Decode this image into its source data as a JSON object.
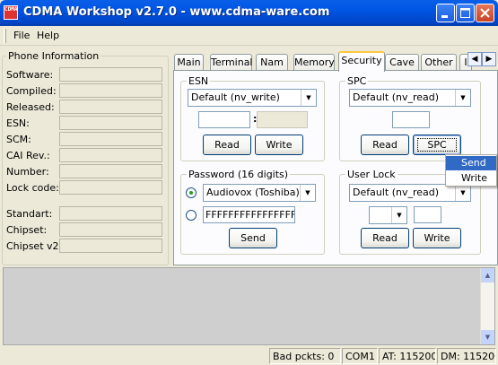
{
  "window": {
    "title": "CDMA Workshop v2.7.0  -  www.cdma-ware.com",
    "icon_text": "CDMA"
  },
  "titlebar_buttons": {
    "minimize_icon": "minimize-icon",
    "maximize_icon": "maximize-icon",
    "close_icon": "close-icon"
  },
  "menu": {
    "file": "File",
    "help": "Help"
  },
  "phone_info": {
    "legend": "Phone Information",
    "labels": {
      "software": "Software:",
      "compiled": "Compiled:",
      "released": "Released:",
      "esn": "ESN:",
      "scm": "SCM:",
      "cai": "CAI Rev.:",
      "number": "Number:",
      "lock_code": "Lock code:",
      "standart": "Standart:",
      "chipset": "Chipset:",
      "chipset_v2": "Chipset v2:"
    }
  },
  "tabs": {
    "main": "Main",
    "terminal": "Terminal",
    "nam": "Nam",
    "memory": "Memory",
    "security": "Security",
    "cave": "Cave",
    "other": "Other",
    "overflow": "I",
    "left_arrow": "◀",
    "right_arrow": "▶"
  },
  "esn_group": {
    "legend": "ESN",
    "mode": "Default (nv_write)",
    "separator": ":",
    "read": "Read",
    "write": "Write"
  },
  "spc_group": {
    "legend": "SPC",
    "mode": "Default (nv_read)",
    "read": "Read",
    "spc": "SPC"
  },
  "password_group": {
    "legend": "Password (16 digits)",
    "preset": "Audiovox (Toshiba)",
    "custom_value": "FFFFFFFFFFFFFFFF",
    "send": "Send"
  },
  "userlock_group": {
    "legend": "User Lock",
    "mode": "Default (nv_read)",
    "read": "Read",
    "write": "Write"
  },
  "popup_menu": {
    "send": "Send",
    "write": "Write"
  },
  "status": {
    "bad_packets": "Bad pckts: 0",
    "port": "COM1",
    "at": "AT: 115200",
    "dm": "DM: 115200"
  },
  "colors": {
    "titlebar": "#0054e3",
    "window_bg": "#ece9d8",
    "tab_highlight": "#ffc83c",
    "menu_highlight": "#316ac5",
    "log_bg": "#cfcfcf"
  }
}
